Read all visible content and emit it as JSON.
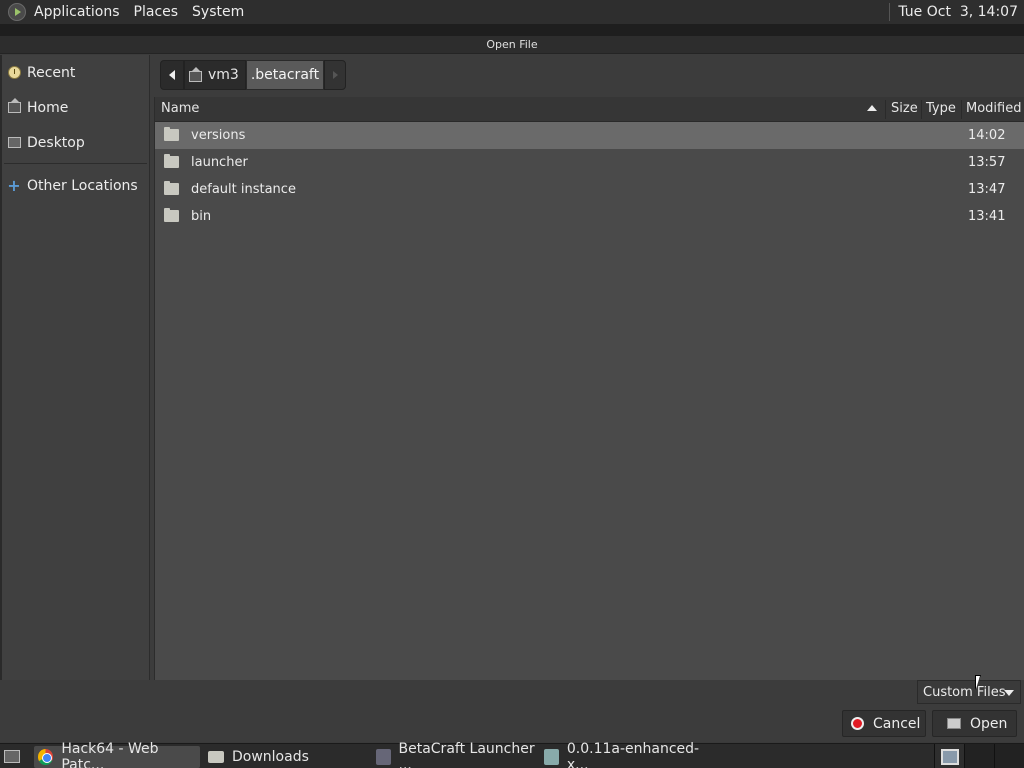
{
  "top_panel": {
    "menu": [
      "Applications",
      "Places",
      "System"
    ],
    "clock": "Tue Oct  3, 14:07"
  },
  "dialog": {
    "title": "Open File",
    "sidebar": [
      {
        "label": "Recent",
        "icon": "clock-icon"
      },
      {
        "label": "Home",
        "icon": "home-icon"
      },
      {
        "label": "Desktop",
        "icon": "desktop-icon"
      },
      {
        "label": "Other Locations",
        "icon": "plus-icon"
      }
    ],
    "path": {
      "segments": [
        "vm3",
        ".betacraft"
      ]
    },
    "columns": {
      "name": "Name",
      "size": "Size",
      "type": "Type",
      "modified": "Modified"
    },
    "files": [
      {
        "name": "versions",
        "modified": "14:02",
        "selected": true
      },
      {
        "name": "launcher",
        "modified": "13:57",
        "selected": false
      },
      {
        "name": "default instance",
        "modified": "13:47",
        "selected": false
      },
      {
        "name": "bin",
        "modified": "13:41",
        "selected": false
      }
    ],
    "filter": "Custom Files",
    "buttons": {
      "cancel": "Cancel",
      "open": "Open"
    }
  },
  "taskbar": {
    "items": [
      {
        "label": "Hack64 - Web Patc...",
        "icon": "chrome-icon",
        "active": true
      },
      {
        "label": "Downloads",
        "icon": "folder-icon",
        "active": false
      },
      {
        "label": "BetaCraft Launcher ...",
        "icon": "java-icon",
        "active": false
      },
      {
        "label": "0.0.11a-enhanced-x...",
        "icon": "document-icon",
        "active": false
      }
    ]
  },
  "colors": {
    "panel": "#2e2e2e",
    "dialog_bg": "#3c3c3c",
    "list_bg": "#4a4a4a",
    "selection": "#6a6a6a",
    "cancel_red": "#e01b24"
  }
}
